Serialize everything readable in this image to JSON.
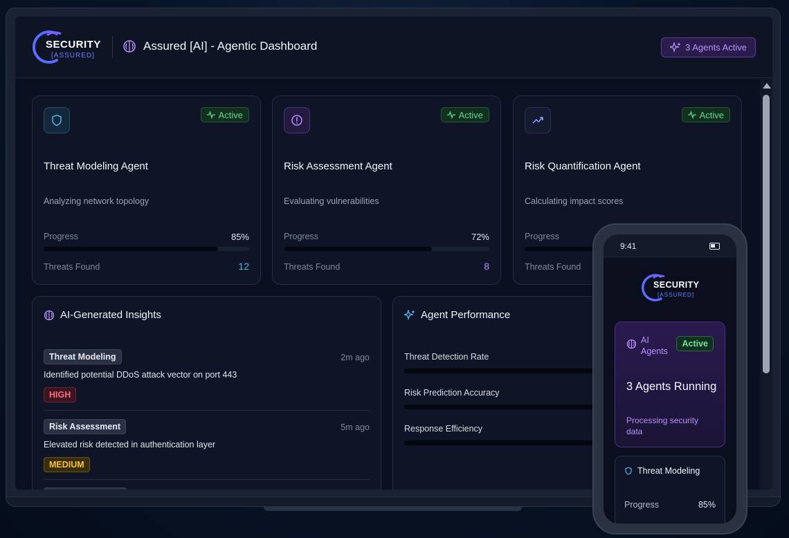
{
  "brand": {
    "line1": "SECURITY",
    "line2": "[ASSURED]"
  },
  "header": {
    "title": "Assured [AI] - Agentic Dashboard",
    "agents_badge": "3 Agents Active"
  },
  "agents": [
    {
      "icon": "shield-icon",
      "status": "Active",
      "name": "Threat Modeling Agent",
      "task": "Analyzing network topology",
      "progress_label": "Progress",
      "progress": "85%",
      "progress_fraction": 0.85,
      "threats_label": "Threats Found",
      "threats": "12",
      "accent": "#4fb8e8"
    },
    {
      "icon": "alert-circle-icon",
      "status": "Active",
      "name": "Risk Assessment Agent",
      "task": "Evaluating vulnerabilities",
      "progress_label": "Progress",
      "progress": "72%",
      "progress_fraction": 0.72,
      "threats_label": "Threats Found",
      "threats": "8",
      "accent": "#b88cff"
    },
    {
      "icon": "trending-up-icon",
      "status": "Active",
      "name": "Risk Quantification Agent",
      "task": "Calculating impact scores",
      "progress_label": "Progress",
      "threats_label": "Threats Found",
      "accent": "#8fa8ff"
    }
  ],
  "insights": {
    "title": "AI-Generated Insights",
    "items": [
      {
        "tag": "Threat Modeling",
        "time": "2m ago",
        "text": "Identified potential DDoS attack vector on port 443",
        "severity": "HIGH"
      },
      {
        "tag": "Risk Assessment",
        "time": "5m ago",
        "text": "Elevated risk detected in authentication layer",
        "severity": "MEDIUM"
      }
    ]
  },
  "performance": {
    "title": "Agent Performance",
    "metrics": [
      {
        "label": "Threat Detection Rate"
      },
      {
        "label": "Risk Prediction Accuracy"
      },
      {
        "label": "Response Efficiency"
      }
    ]
  },
  "phone": {
    "time": "9:41",
    "ai_card": {
      "label_line1": "AI",
      "label_line2": "Agents",
      "status": "Active",
      "title": "3 Agents Running",
      "subtitle": "Processing security data"
    },
    "tm_card": {
      "title": "Threat Modeling",
      "progress_label": "Progress",
      "progress": "85%"
    }
  },
  "colors": {
    "accent_purple": "#b990ff",
    "active_green": "#5fd98a",
    "high_red": "#ff6b7f",
    "medium_yellow": "#f7c333"
  }
}
